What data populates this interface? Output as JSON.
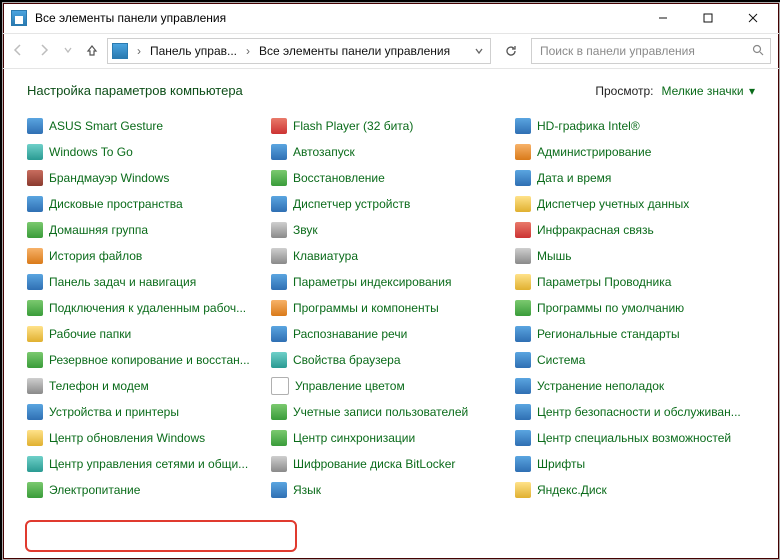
{
  "window": {
    "title": "Все элементы панели управления"
  },
  "nav": {
    "crumb1": "Панель управ...",
    "crumb2": "Все элементы панели управления"
  },
  "search": {
    "placeholder": "Поиск в панели управления"
  },
  "header": {
    "title": "Настройка параметров компьютера",
    "viewby_label": "Просмотр:",
    "viewby_value": "Мелкие значки"
  },
  "items": {
    "col1": [
      {
        "label": "ASUS Smart Gesture",
        "icon": "gesture-icon",
        "color": "c-blue"
      },
      {
        "label": "Windows To Go",
        "icon": "wintogo-icon",
        "color": "c-teal"
      },
      {
        "label": "Брандмауэр Windows",
        "icon": "firewall-icon",
        "color": "c-brick"
      },
      {
        "label": "Дисковые пространства",
        "icon": "storage-spaces-icon",
        "color": "c-blue"
      },
      {
        "label": "Домашняя группа",
        "icon": "homegroup-icon",
        "color": "c-green"
      },
      {
        "label": "История файлов",
        "icon": "file-history-icon",
        "color": "c-orange"
      },
      {
        "label": "Панель задач и навигация",
        "icon": "taskbar-icon",
        "color": "c-blue"
      },
      {
        "label": "Подключения к удаленным рабоч...",
        "icon": "remoteapp-icon",
        "color": "c-green"
      },
      {
        "label": "Рабочие папки",
        "icon": "work-folders-icon",
        "color": "c-yellow"
      },
      {
        "label": "Резервное копирование и восстан...",
        "icon": "backup-icon",
        "color": "c-green"
      },
      {
        "label": "Телефон и модем",
        "icon": "phone-modem-icon",
        "color": "c-gray"
      },
      {
        "label": "Устройства и принтеры",
        "icon": "devices-printers-icon",
        "color": "c-blue"
      },
      {
        "label": "Центр обновления Windows",
        "icon": "windows-update-icon",
        "color": "c-yellow"
      },
      {
        "label": "Центр управления сетями и общи...",
        "icon": "network-sharing-icon",
        "color": "c-teal"
      },
      {
        "label": "Электропитание",
        "icon": "power-options-icon",
        "color": "c-green"
      }
    ],
    "col2": [
      {
        "label": "Flash Player (32 бита)",
        "icon": "flash-icon",
        "color": "c-red"
      },
      {
        "label": "Автозапуск",
        "icon": "autoplay-icon",
        "color": "c-blue"
      },
      {
        "label": "Восстановление",
        "icon": "recovery-icon",
        "color": "c-green"
      },
      {
        "label": "Диспетчер устройств",
        "icon": "device-manager-icon",
        "color": "c-blue"
      },
      {
        "label": "Звук",
        "icon": "sound-icon",
        "color": "c-gray"
      },
      {
        "label": "Клавиатура",
        "icon": "keyboard-icon",
        "color": "c-gray"
      },
      {
        "label": "Параметры индексирования",
        "icon": "indexing-icon",
        "color": "c-blue"
      },
      {
        "label": "Программы и компоненты",
        "icon": "programs-features-icon",
        "color": "c-orange"
      },
      {
        "label": "Распознавание речи",
        "icon": "speech-icon",
        "color": "c-blue"
      },
      {
        "label": "Свойства браузера",
        "icon": "internet-options-icon",
        "color": "c-teal"
      },
      {
        "label": "Управление цветом",
        "icon": "color-management-icon",
        "color": "c-white"
      },
      {
        "label": "Учетные записи пользователей",
        "icon": "user-accounts-icon",
        "color": "c-green"
      },
      {
        "label": "Центр синхронизации",
        "icon": "sync-center-icon",
        "color": "c-green"
      },
      {
        "label": "Шифрование диска BitLocker",
        "icon": "bitlocker-icon",
        "color": "c-gray"
      },
      {
        "label": "Язык",
        "icon": "language-icon",
        "color": "c-blue"
      }
    ],
    "col3": [
      {
        "label": "HD-графика Intel®",
        "icon": "intel-graphics-icon",
        "color": "c-blue"
      },
      {
        "label": "Администрирование",
        "icon": "admin-tools-icon",
        "color": "c-orange"
      },
      {
        "label": "Дата и время",
        "icon": "date-time-icon",
        "color": "c-blue"
      },
      {
        "label": "Диспетчер учетных данных",
        "icon": "credential-manager-icon",
        "color": "c-yellow"
      },
      {
        "label": "Инфракрасная связь",
        "icon": "infrared-icon",
        "color": "c-red"
      },
      {
        "label": "Мышь",
        "icon": "mouse-icon",
        "color": "c-gray"
      },
      {
        "label": "Параметры Проводника",
        "icon": "explorer-options-icon",
        "color": "c-yellow"
      },
      {
        "label": "Программы по умолчанию",
        "icon": "default-programs-icon",
        "color": "c-green"
      },
      {
        "label": "Региональные стандарты",
        "icon": "region-icon",
        "color": "c-blue"
      },
      {
        "label": "Система",
        "icon": "system-icon",
        "color": "c-blue"
      },
      {
        "label": "Устранение неполадок",
        "icon": "troubleshooting-icon",
        "color": "c-blue"
      },
      {
        "label": "Центр безопасности и обслуживан...",
        "icon": "security-maintenance-icon",
        "color": "c-blue"
      },
      {
        "label": "Центр специальных возможностей",
        "icon": "ease-of-access-icon",
        "color": "c-blue"
      },
      {
        "label": "Шрифты",
        "icon": "fonts-icon",
        "color": "c-blue"
      },
      {
        "label": "Яндекс.Диск",
        "icon": "yandex-disk-icon",
        "color": "c-yellow"
      }
    ]
  },
  "highlight_index": {
    "col": 0,
    "row": 13
  }
}
